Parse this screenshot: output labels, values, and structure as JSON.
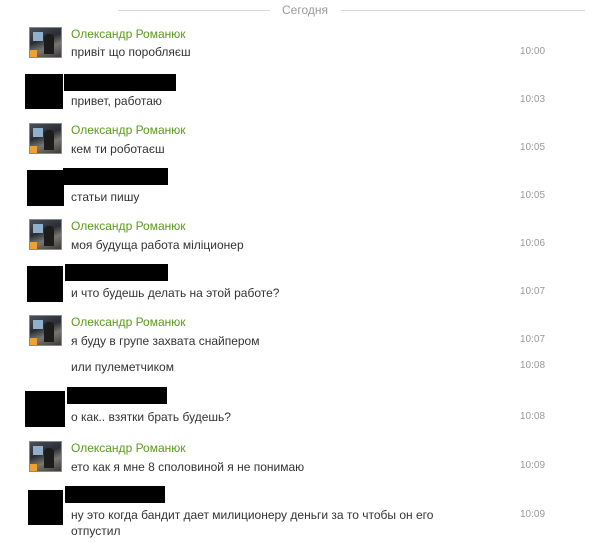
{
  "date_label": "Сегодня",
  "colors": {
    "name": "#5a9a1e",
    "text": "#333333",
    "time": "#999999",
    "divider": "#d9d9d9"
  },
  "messages": [
    {
      "author": "Олександр Романюк",
      "text": "привіт що поробляєш",
      "time": "10:00"
    },
    {
      "author": "",
      "text": "привет, работаю",
      "time": "10:03"
    },
    {
      "author": "Олександр Романюк",
      "text": "кем ти роботаєш",
      "time": "10:05"
    },
    {
      "author": "",
      "text": "статьи пишу",
      "time": "10:05"
    },
    {
      "author": "Олександр Романюк",
      "text": "моя будуща работа міліционер",
      "time": "10:06"
    },
    {
      "author": "",
      "text": "и что будешь делать на этой работе?",
      "time": "10:07"
    },
    {
      "author": "Олександр Романюк",
      "text": "я буду в групе захвата снайпером",
      "time": "10:07"
    },
    {
      "author": "",
      "text": "или пулеметчиком",
      "time": "10:08"
    },
    {
      "author": "",
      "text": "о как.. взятки брать будешь?",
      "time": "10:08"
    },
    {
      "author": "Олександр Романюк",
      "text": "ето как я мне 8 споловиной я не понимаю",
      "time": "10:09"
    },
    {
      "author": "",
      "text": "ну это когда бандит дает милиционеру деньги за то чтобы он его отпустил",
      "time": "10:09"
    }
  ]
}
